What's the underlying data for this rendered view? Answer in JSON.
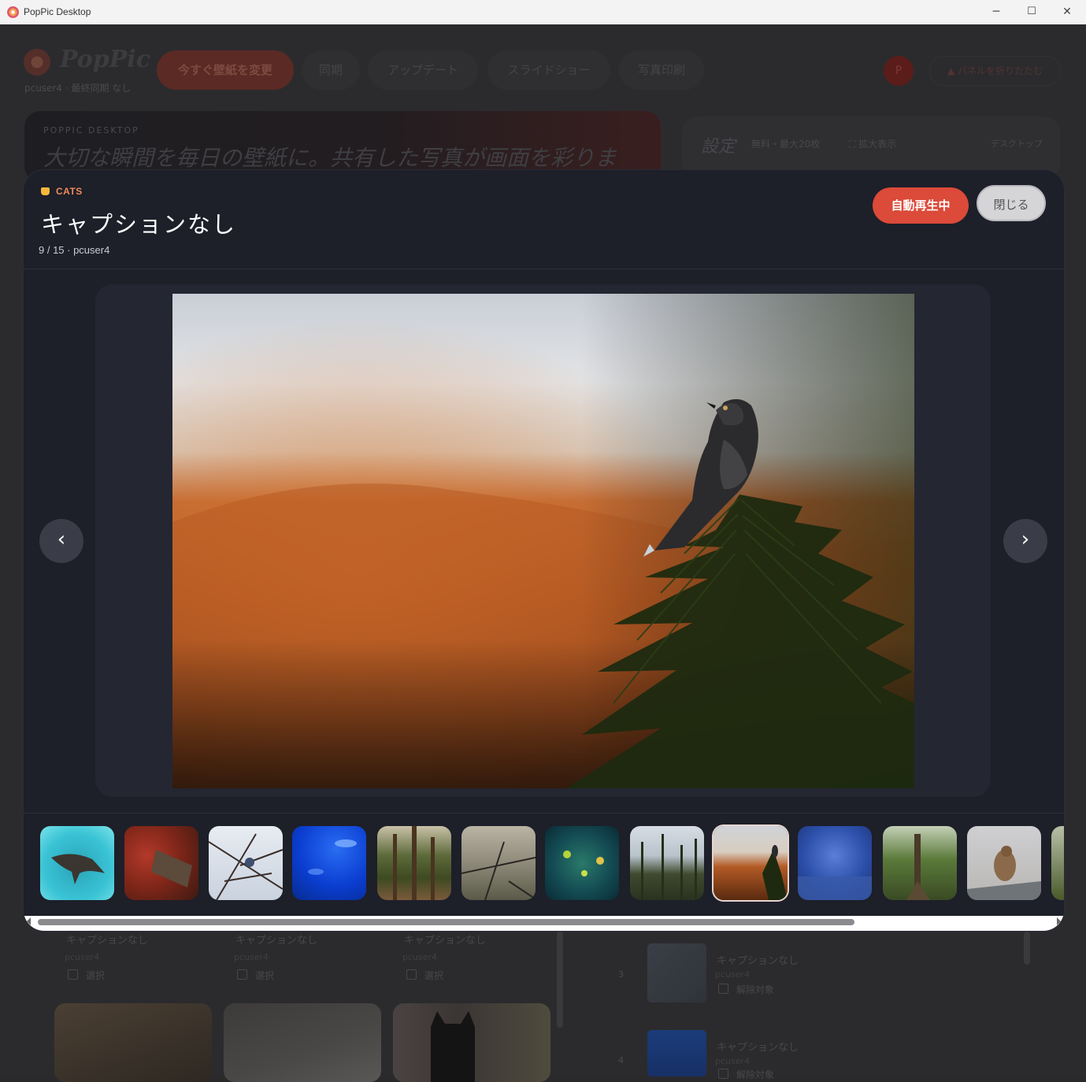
{
  "window": {
    "title": "PopPic Desktop",
    "minimize": "─",
    "maximize": "☐",
    "close": "✕"
  },
  "app": {
    "logo": "PopPic",
    "subtitle": "pcuser4 · 最終同期 なし",
    "primary_action": "今すぐ壁紙を変更",
    "nav": [
      "同期",
      "アップデート",
      "スライドショー",
      "写真印刷"
    ],
    "avatar_initial": "P",
    "collapse_label": "▲ パネルを折りたたむ",
    "hero_eyebrow": "POPPIC DESKTOP",
    "hero_headline": "大切な瞬間を毎日の壁紙に。共有した写真が画面を彩りま",
    "settings_title": "設定",
    "settings_plan": "無料・最大20枚",
    "settings_zoom": "⛶ 拡大表示",
    "settings_right": "デスクトップ"
  },
  "gallery": {
    "cards": [
      {
        "caption": "キャプションなし",
        "user": "pcuser4",
        "checkbox": "選択"
      },
      {
        "caption": "キャプションなし",
        "user": "pcuser4",
        "checkbox": "選択"
      },
      {
        "caption": "キャプションなし",
        "user": "pcuser4",
        "checkbox": "選択"
      }
    ],
    "queue": [
      {
        "rank": "3",
        "caption": "キャプションなし",
        "user": "pcuser4",
        "checkbox": "解除対象"
      },
      {
        "rank": "4",
        "caption": "キャプションなし",
        "user": "pcuser4",
        "checkbox": "解除対象"
      }
    ]
  },
  "viewer": {
    "category": "CATS",
    "title": "キャプションなし",
    "meta": "9 / 15 · pcuser4",
    "autoplay_label": "自動再生中",
    "close_label": "閉じる",
    "prev_label": "‹",
    "next_label": "›",
    "current_index": 9,
    "total": 15,
    "thumbnails": [
      "shark-in-water",
      "autumn-leaves-log",
      "bird-in-bare-branches",
      "blue-aquarium-fish",
      "forest-trees",
      "bird-on-twigs",
      "reef-fish",
      "pine-forest-sunrise",
      "bird-on-pine-orange-bg",
      "blue-reef-rocks",
      "forest-stump",
      "sparrow-on-rock",
      "forest-edge"
    ]
  },
  "colors": {
    "accent": "#dc4a39",
    "category": "#f08b5a",
    "modal_bg": "#1d1f29"
  }
}
